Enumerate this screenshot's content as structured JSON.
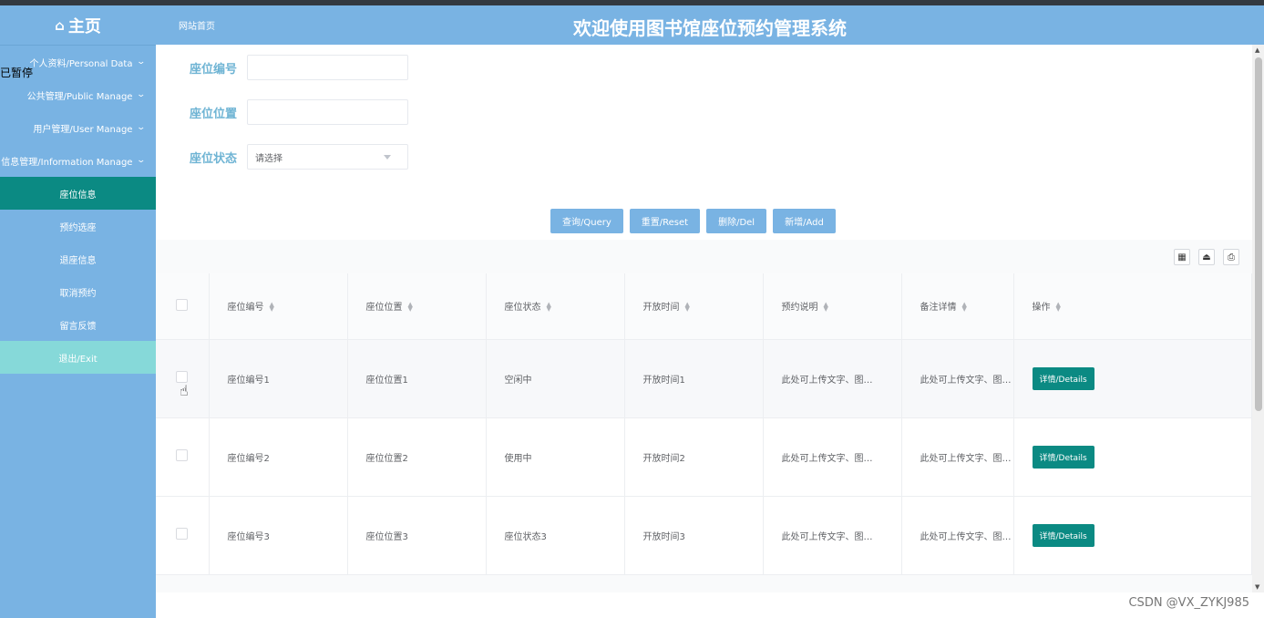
{
  "header": {
    "home_label": "主页",
    "breadcrumb": "网站首页",
    "title": "欢迎使用图书馆座位预约管理系统"
  },
  "overlay_text": "已暂停",
  "sidebar": {
    "groups": [
      {
        "label": "个人资料/Personal Data"
      },
      {
        "label": "公共管理/Public Manage"
      },
      {
        "label": "用户管理/User Manage"
      },
      {
        "label": "信息管理/Information Manage"
      }
    ],
    "items": [
      {
        "label": "座位信息",
        "active": true
      },
      {
        "label": "预约选座"
      },
      {
        "label": "退座信息"
      },
      {
        "label": "取消预约"
      },
      {
        "label": "留言反馈"
      }
    ],
    "exit_label": "退出/Exit"
  },
  "search": {
    "fields": [
      {
        "label": "座位编号",
        "value": ""
      },
      {
        "label": "座位位置",
        "value": ""
      },
      {
        "label": "座位状态",
        "value": "请选择"
      }
    ]
  },
  "actions": {
    "query": "查询/Query",
    "reset": "重置/Reset",
    "delete": "删除/Del",
    "add": "新增/Add"
  },
  "table": {
    "columns": [
      "座位编号",
      "座位位置",
      "座位状态",
      "开放时间",
      "预约说明",
      "备注详情",
      "操作"
    ],
    "rows": [
      {
        "no": "座位编号1",
        "pos": "座位位置1",
        "status": "空闲中",
        "open": "开放时间1",
        "desc": "此处可上传文字、图…",
        "note": "此处可上传文字、图…",
        "op": "详情/Details"
      },
      {
        "no": "座位编号2",
        "pos": "座位位置2",
        "status": "使用中",
        "open": "开放时间2",
        "desc": "此处可上传文字、图…",
        "note": "此处可上传文字、图…",
        "op": "详情/Details"
      },
      {
        "no": "座位编号3",
        "pos": "座位位置3",
        "status": "座位状态3",
        "open": "开放时间3",
        "desc": "此处可上传文字、图…",
        "note": "此处可上传文字、图…",
        "op": "详情/Details"
      }
    ]
  },
  "watermark": "CSDN @VX_ZYKJ985",
  "colors": {
    "sidebar": "#79b3e3",
    "active": "#0b8a83",
    "exit": "#86d9d9",
    "label": "#6fb4d4"
  }
}
